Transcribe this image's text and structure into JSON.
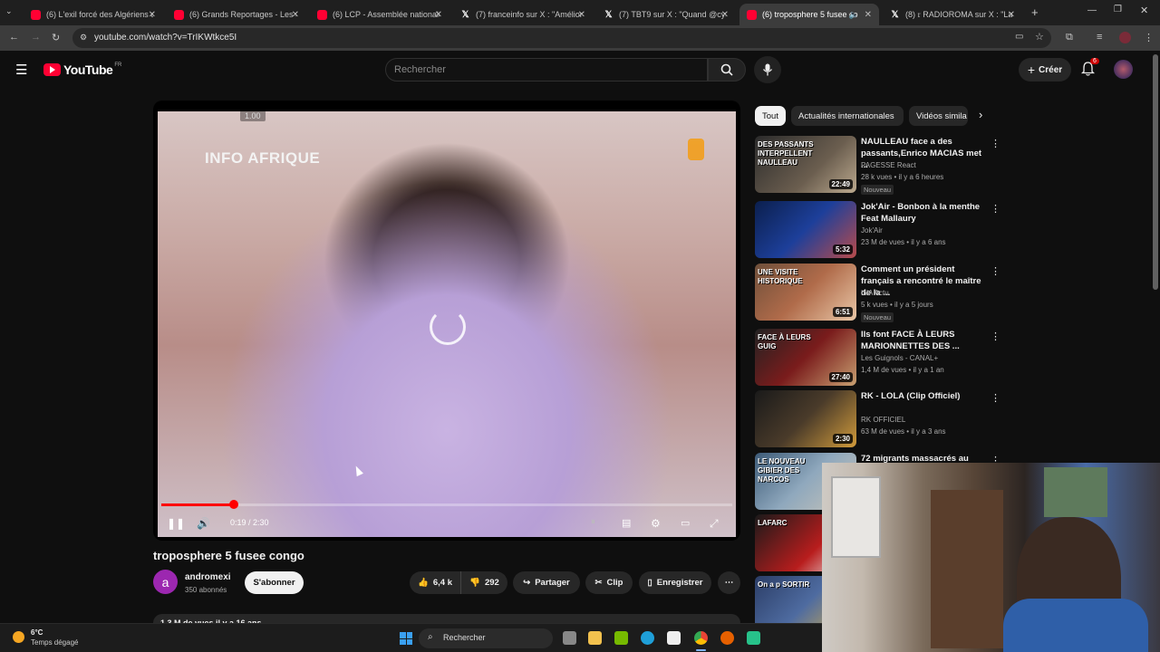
{
  "browser": {
    "tabs": [
      {
        "title": "(6) L'exil forcé des Algériens en",
        "type": "youtube"
      },
      {
        "title": "(6) Grands Reportages - Les exp",
        "type": "youtube"
      },
      {
        "title": "(6) LCP - Assemblée nationale",
        "type": "youtube"
      },
      {
        "title": "(7) franceinfo sur X : \"Amélioré",
        "type": "x"
      },
      {
        "title": "(7) TBT9 sur X : \"Quand @cyrill",
        "type": "x"
      },
      {
        "title": "(6) troposphere 5 fusee co",
        "type": "youtube",
        "active": true
      },
      {
        "title": "(8) 𝔯 RADIOROMA sur X : \"La d",
        "type": "x"
      }
    ],
    "new_tab": "+",
    "url": "youtube.com/watch?v=TrIKWtkce5I"
  },
  "youtube": {
    "logo_text": "YouTube",
    "region": "FR",
    "search_placeholder": "Rechercher",
    "create_label": "Créer",
    "notifications_count": "6"
  },
  "player": {
    "overlay_text": "INFO AFRIQUE",
    "speed_tip": "1.00",
    "current_time": "0:19",
    "duration": "2:30",
    "time_text": "0:19 / 2:30",
    "progress": 0.127
  },
  "video": {
    "title": "troposphere 5 fusee congo",
    "channel_initial": "a",
    "channel": "andromexi",
    "subscribers": "350 abonnés",
    "subscribe_label": "S'abonner",
    "likes": "6,4 k",
    "dislikes": "292",
    "share_label": "Partager",
    "clip_label": "Clip",
    "save_label": "Enregistrer",
    "description_line": "1,3 M de vues  il y a 16 ans"
  },
  "chips": [
    "Tout",
    "Actualités internationales",
    "Vidéos simila"
  ],
  "recommendations": [
    {
      "title": "NAULLEAU face a des passants,Enrico MACIAS met ...",
      "channel": "PAGESSE React",
      "meta": "28 k vues • il y a 6 heures",
      "badge": "Nouveau",
      "duration": "22:49",
      "thumb_text": "DES PASSANTS INTERPELLENT NAULLEAU"
    },
    {
      "title": "Jok'Air - Bonbon à la menthe Feat Mallaury",
      "channel": "Jok'Air",
      "meta": "23 M de vues • il y a 6 ans",
      "badge": "",
      "duration": "5:32",
      "thumb_text": ""
    },
    {
      "title": "Comment un président français a rencontré le maître de la ...",
      "channel": "INA Actu",
      "meta": "5 k vues • il y a 5 jours",
      "badge": "Nouveau",
      "duration": "6:51",
      "thumb_text": "UNE VISITE HISTORIQUE"
    },
    {
      "title": "Ils font FACE À LEURS MARIONNETTES DES ...",
      "channel": "Les Guignols - CANAL+",
      "meta": "1,4 M de vues • il y a 1 an",
      "badge": "",
      "duration": "27:40",
      "thumb_text": "FACE À LEURS GUIG"
    },
    {
      "title": "RK - LOLA (Clip Officiel)",
      "channel": "RK OFFICIEL",
      "meta": "63 M de vues • il y a 3 ans",
      "badge": "",
      "duration": "2:30",
      "thumb_text": ""
    },
    {
      "title": "72 migrants massacrés au",
      "channel": "",
      "meta": "",
      "badge": "",
      "duration": "",
      "thumb_text": "LE NOUVEAU GIBIER DES NARCOS"
    },
    {
      "title": "",
      "channel": "",
      "meta": "",
      "badge": "",
      "duration": "",
      "thumb_text": "LAFARC"
    },
    {
      "title": "",
      "channel": "",
      "meta": "",
      "badge": "",
      "duration": "",
      "thumb_text": "On a p SORTIR"
    }
  ],
  "taskbar": {
    "temperature": "6°C",
    "weather": "Temps dégagé",
    "search_label": "Rechercher"
  },
  "colors": {
    "youtube_red": "#ff0033",
    "bg": "#0f0f0f",
    "chip_bg": "#272727"
  }
}
